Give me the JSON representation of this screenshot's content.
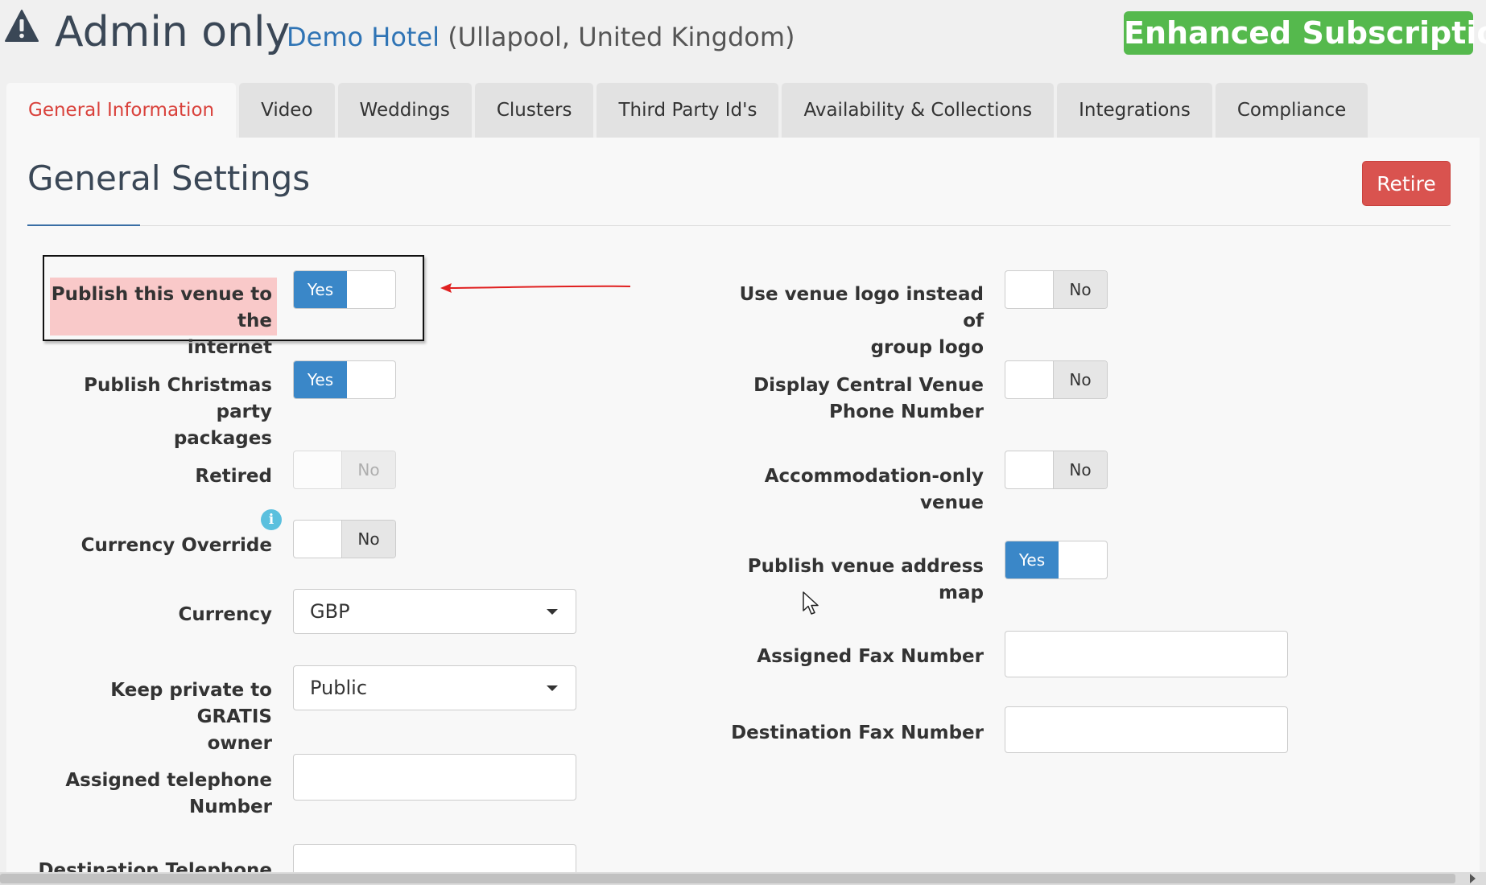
{
  "header": {
    "title": "Admin only",
    "hotel_name": "Demo Hotel",
    "hotel_location": "(Ullapool, United Kingdom)",
    "subscription": "Enhanced Subscription",
    "icon": "warning-triangle-icon"
  },
  "tabs": [
    {
      "label": "General Information",
      "active": true
    },
    {
      "label": "Video"
    },
    {
      "label": "Weddings"
    },
    {
      "label": "Clusters"
    },
    {
      "label": "Third Party Id's"
    },
    {
      "label": "Availability & Collections"
    },
    {
      "label": "Integrations"
    },
    {
      "label": "Compliance"
    }
  ],
  "section": {
    "title": "General Settings",
    "retire_label": "Retire"
  },
  "left_fields": {
    "publish_internet": {
      "line1": "Publish this venue to the",
      "line2": "internet",
      "value": "Yes"
    },
    "publish_christmas": {
      "line1": "Publish Christmas party",
      "line2": "packages",
      "value": "Yes"
    },
    "retired": {
      "label": "Retired",
      "value": "No"
    },
    "currency_override": {
      "label": "Currency Override",
      "value": "No"
    },
    "currency": {
      "label": "Currency",
      "value": "GBP"
    },
    "keep_private": {
      "line1": "Keep private to GRATIS",
      "line2": "owner",
      "value": "Public"
    },
    "assigned_telephone": {
      "line1": "Assigned telephone",
      "line2": "Number",
      "value": ""
    },
    "destination_telephone": {
      "label": "Destination Telephone",
      "value": ""
    }
  },
  "right_fields": {
    "venue_logo": {
      "line1": "Use venue logo instead of",
      "line2": "group logo",
      "value": "No"
    },
    "central_phone": {
      "line1": "Display Central Venue",
      "line2": "Phone Number",
      "value": "No"
    },
    "accommodation_only": {
      "line1": "Accommodation-only",
      "line2": "venue",
      "value": "No"
    },
    "address_map": {
      "line1": "Publish venue address",
      "line2": "map",
      "value": "Yes"
    },
    "assigned_fax": {
      "label": "Assigned Fax Number",
      "value": ""
    },
    "destination_fax": {
      "label": "Destination Fax Number",
      "value": ""
    }
  },
  "colors": {
    "accent_red": "#d9413b",
    "toggle_blue": "#3a87c8",
    "subscription_green": "#55b94d",
    "highlight_pink": "#f9c9c9",
    "arrow_red": "#e02020"
  }
}
